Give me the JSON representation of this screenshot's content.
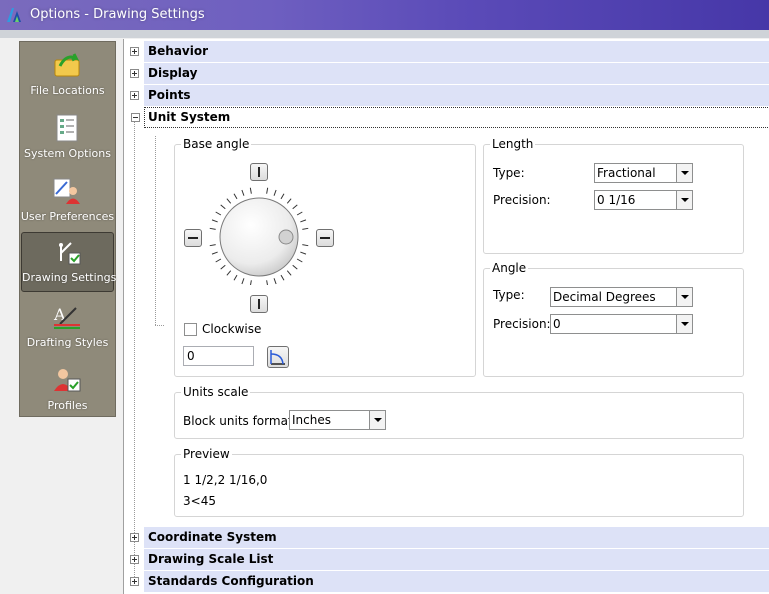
{
  "window": {
    "title": "Options - Drawing Settings"
  },
  "nav": {
    "items": [
      {
        "label": "File Locations",
        "icon": "folder-arrow-icon"
      },
      {
        "label": "System Options",
        "icon": "checklist-icon"
      },
      {
        "label": "User Preferences",
        "icon": "user-pencil-icon"
      },
      {
        "label": "Drawing Settings",
        "icon": "drawing-settings-icon",
        "selected": true
      },
      {
        "label": "Drafting Styles",
        "icon": "drafting-styles-icon"
      },
      {
        "label": "Profiles",
        "icon": "profiles-icon"
      }
    ]
  },
  "sections": {
    "behavior": "Behavior",
    "display": "Display",
    "points": "Points",
    "unit_system": "Unit System",
    "coordinate_system": "Coordinate System",
    "drawing_scale_list": "Drawing Scale List",
    "standards_configuration": "Standards Configuration"
  },
  "base_angle": {
    "label": "Base angle",
    "clockwise_label": "Clockwise",
    "clockwise_checked": false,
    "value": "0"
  },
  "length": {
    "label": "Length",
    "type_label": "Type:",
    "type_value": "Fractional",
    "precision_label": "Precision:",
    "precision_value": "0 1/16"
  },
  "angle": {
    "label": "Angle",
    "type_label": "Type:",
    "type_value": "Decimal Degrees",
    "precision_label": "Precision:",
    "precision_value": "0"
  },
  "units_scale": {
    "label": "Units scale",
    "block_units_label": "Block units format:",
    "block_units_value": "Inches"
  },
  "preview": {
    "label": "Preview",
    "line1": "1 1/2,2 1/16,0",
    "line2": "3<45"
  },
  "colors": {
    "title_bar": "#6e5fc0",
    "nav_bg": "#8f8a7a",
    "section_bg": "#dde2f7"
  }
}
